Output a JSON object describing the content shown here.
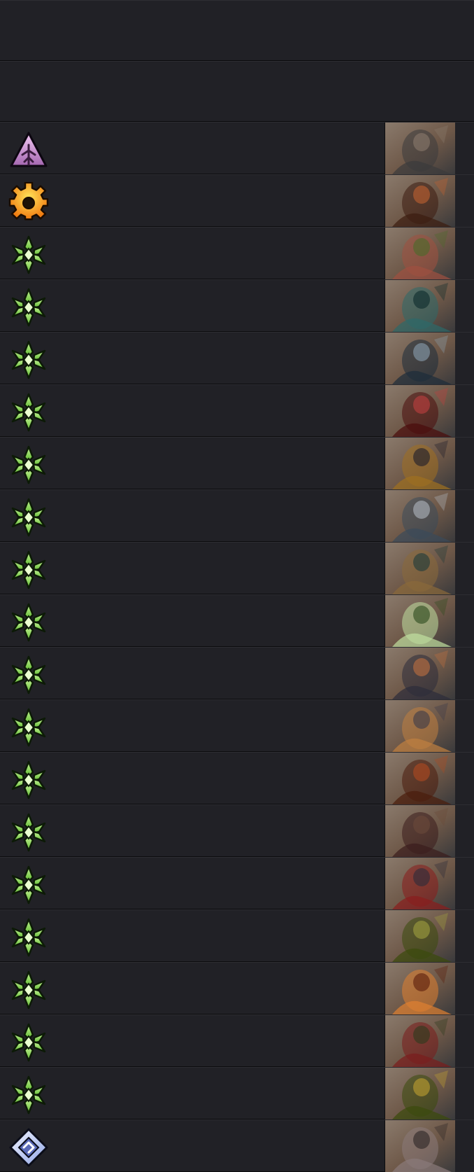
{
  "header_rows": [
    {
      "name": "header-row-1"
    },
    {
      "name": "header-row-2"
    }
  ],
  "colors": {
    "background": "#1e1e21",
    "row": "#212126",
    "divider": "#0c0c0e"
  },
  "rows": [
    {
      "rarity": "epic",
      "rarity_icon": "purple-triangle-rune-icon",
      "portrait": "dwarf-warrior-shield-portrait",
      "palette": [
        "#6e5848",
        "#3a3a3c",
        "#8a7a6c"
      ]
    },
    {
      "rarity": "legendary",
      "rarity_icon": "orange-cog-rune-icon",
      "portrait": "brawler-orc-portrait",
      "palette": [
        "#7a3c1c",
        "#3c1c10",
        "#c06030"
      ]
    },
    {
      "rarity": "common",
      "rarity_icon": "green-leaf-rune-icon",
      "portrait": "forest-spirit-portrait",
      "palette": [
        "#6c6a3a",
        "#a05040",
        "#4a6a2a"
      ]
    },
    {
      "rarity": "common",
      "rarity_icon": "green-leaf-rune-icon",
      "portrait": "sea-serpent-portrait",
      "palette": [
        "#1c4a4c",
        "#2c6a6a",
        "#0c2a2c"
      ]
    },
    {
      "rarity": "common",
      "rarity_icon": "green-leaf-rune-icon",
      "portrait": "hooded-sage-portrait",
      "palette": [
        "#4a6a7a",
        "#1c2c3a",
        "#8aa0b0"
      ]
    },
    {
      "rarity": "common",
      "rarity_icon": "green-leaf-rune-icon",
      "portrait": "red-troll-portrait",
      "palette": [
        "#7a1c1c",
        "#4a0c0c",
        "#c04040"
      ]
    },
    {
      "rarity": "common",
      "rarity_icon": "green-leaf-rune-icon",
      "portrait": "valkyrie-portrait",
      "palette": [
        "#3a2c5a",
        "#a07020",
        "#1c1c2c"
      ]
    },
    {
      "rarity": "common",
      "rarity_icon": "green-leaf-rune-icon",
      "portrait": "old-swordsman-portrait",
      "palette": [
        "#6a8aa0",
        "#3a4a5a",
        "#b0b8c0"
      ]
    },
    {
      "rarity": "common",
      "rarity_icon": "green-leaf-rune-icon",
      "portrait": "hunter-pair-portrait",
      "palette": [
        "#3a6a5a",
        "#8a6a3a",
        "#1c3a3a"
      ]
    },
    {
      "rarity": "common",
      "rarity_icon": "green-leaf-rune-icon",
      "portrait": "stag-hunter-portrait",
      "palette": [
        "#5a8a2a",
        "#c0e0a0",
        "#2c4a1c"
      ]
    },
    {
      "rarity": "common",
      "rarity_icon": "green-leaf-rune-icon",
      "portrait": "berserker-portrait",
      "palette": [
        "#8a4a2a",
        "#2c2c3a",
        "#c07040"
      ]
    },
    {
      "rarity": "common",
      "rarity_icon": "green-leaf-rune-icon",
      "portrait": "bearded-warrior-portrait",
      "palette": [
        "#7a8aa0",
        "#c08040",
        "#3a3a4a"
      ]
    },
    {
      "rarity": "common",
      "rarity_icon": "green-leaf-rune-icon",
      "portrait": "crimson-beast-portrait",
      "palette": [
        "#7a2c10",
        "#4a1c0c",
        "#b04a20"
      ]
    },
    {
      "rarity": "common",
      "rarity_icon": "green-leaf-rune-icon",
      "portrait": "axe-warrior-portrait",
      "palette": [
        "#8a3c2c",
        "#3a1c1c",
        "#6a4a3a"
      ]
    },
    {
      "rarity": "common",
      "rarity_icon": "green-leaf-rune-icon",
      "portrait": "armored-knight-portrait",
      "palette": [
        "#4a4a5a",
        "#8a1c1c",
        "#2c2c3a"
      ]
    },
    {
      "rarity": "common",
      "rarity_icon": "green-leaf-rune-icon",
      "portrait": "forest-bear-portrait",
      "palette": [
        "#6a7a1c",
        "#3a4a0c",
        "#a0a040"
      ]
    },
    {
      "rarity": "common",
      "rarity_icon": "green-leaf-rune-icon",
      "portrait": "sunset-wanderer-portrait",
      "palette": [
        "#c0501c",
        "#e08030",
        "#5a1c0c"
      ]
    },
    {
      "rarity": "common",
      "rarity_icon": "green-leaf-rune-icon",
      "portrait": "bloodied-ranger-portrait",
      "palette": [
        "#3a5a2a",
        "#7a1c1c",
        "#2c3a1c"
      ]
    },
    {
      "rarity": "common",
      "rarity_icon": "green-leaf-rune-icon",
      "portrait": "jungle-ape-portrait",
      "palette": [
        "#7a7a1c",
        "#3a4a0c",
        "#c0a030"
      ]
    },
    {
      "rarity": "rare",
      "rarity_icon": "blue-diamond-rune-icon",
      "portrait": "stone-golems-portrait",
      "palette": [
        "#5a4a4a",
        "#8a7a7a",
        "#2c2424"
      ]
    }
  ]
}
